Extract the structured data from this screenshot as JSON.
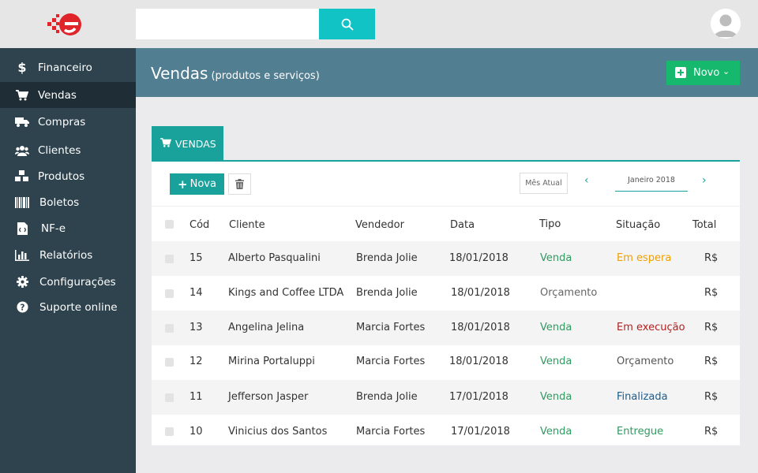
{
  "search": {
    "value": "",
    "placeholder": ""
  },
  "sidebar": {
    "items": [
      {
        "label": "Financeiro",
        "icon": "dollar-icon"
      },
      {
        "label": "Vendas",
        "icon": "cart-icon",
        "active": true
      },
      {
        "label": "Compras",
        "icon": "truck-icon"
      },
      {
        "label": "Clientes",
        "icon": "users-icon"
      },
      {
        "label": "Produtos",
        "icon": "cubes-icon"
      },
      {
        "label": "Boletos",
        "icon": "barcode-icon"
      },
      {
        "label": "NF-e",
        "icon": "file-code-icon"
      },
      {
        "label": "Relatórios",
        "icon": "bar-chart-icon"
      },
      {
        "label": "Configurações",
        "icon": "gear-icon"
      },
      {
        "label": "Suporte online",
        "icon": "question-circle-icon"
      }
    ]
  },
  "header": {
    "title": "Vendas",
    "subtitle": "(produtos e serviços)",
    "new_button": "Novo"
  },
  "tab": {
    "label": "VENDAS"
  },
  "toolbar": {
    "nova_label": "Nova",
    "current_month_label": "Mês Atual",
    "month_value": "Janeiro 2018"
  },
  "table": {
    "columns": [
      "Cód",
      "Cliente",
      "Vendedor",
      "Data",
      "Tipo",
      "Situação",
      "Total"
    ],
    "rows": [
      {
        "cod": "15",
        "cliente": "Alberto Pasqualini",
        "vendedor": "Brenda Jolie",
        "data": "18/01/2018",
        "tipo": "Venda",
        "situacao": "Em espera",
        "total": "R$"
      },
      {
        "cod": "14",
        "cliente": "Kings and Coffee LTDA",
        "vendedor": "Brenda Jolie",
        "data": "18/01/2018",
        "tipo": "Orçamento",
        "situacao": "",
        "total": "R$"
      },
      {
        "cod": "13",
        "cliente": "Angelina Jelina",
        "vendedor": "Marcia Fortes",
        "data": "18/01/2018",
        "tipo": "Venda",
        "situacao": "Em execução",
        "total": "R$"
      },
      {
        "cod": "12",
        "cliente": "Mirina Portaluppi",
        "vendedor": "Marcia Fortes",
        "data": "18/01/2018",
        "tipo": "Venda",
        "situacao": "Orçamento",
        "total": "R$"
      },
      {
        "cod": "11",
        "cliente": "Jefferson Jasper",
        "vendedor": "Brenda Jolie",
        "data": "17/01/2018",
        "tipo": "Venda",
        "situacao": "Finalizada",
        "total": "R$"
      },
      {
        "cod": "10",
        "cliente": "Vinicius dos Santos",
        "vendedor": "Marcia Fortes",
        "data": "17/01/2018",
        "tipo": "Venda",
        "situacao": "Entregue",
        "total": "R$"
      }
    ]
  },
  "colors": {
    "accent": "#19a29c",
    "search_button": "#11c3c4",
    "sidebar_bg": "#2e434e",
    "header_bg": "#527e92",
    "new_button": "#15b86c",
    "tipo_venda": "#2e9b60",
    "tipo_orcamento": "#666666",
    "situacao_em_espera": "#f0a000",
    "situacao_em_execucao": "#b32020",
    "situacao_orcamento": "#555555",
    "situacao_finalizada": "#1a5d8f",
    "situacao_entregue": "#2e9b60"
  }
}
